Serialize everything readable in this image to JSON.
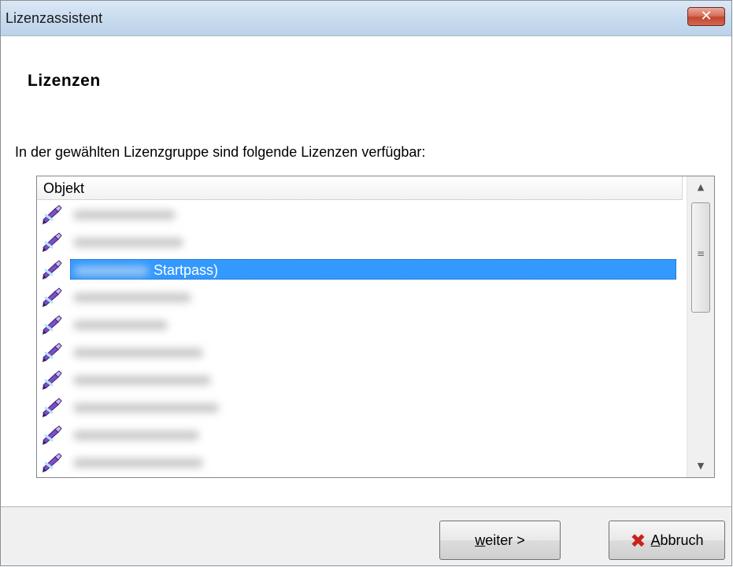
{
  "window": {
    "title": "Lizenzassistent",
    "close_glyph": "✕"
  },
  "page": {
    "heading": "Lizenzen",
    "description": "In der gewählten Lizenzgruppe sind folgende Lizenzen verfügbar:"
  },
  "list": {
    "column_header": "Objekt",
    "selected_index": 2,
    "rows": [
      {
        "label": "",
        "icon": "license-pen-icon"
      },
      {
        "label": "",
        "icon": "license-pen-icon"
      },
      {
        "label": "Startpass)",
        "icon": "license-pen-icon"
      },
      {
        "label": "",
        "icon": "license-pen-icon"
      },
      {
        "label": "",
        "icon": "license-pen-icon"
      },
      {
        "label": "",
        "icon": "license-pen-icon"
      },
      {
        "label": "",
        "icon": "license-pen-icon"
      },
      {
        "label": "",
        "icon": "license-pen-icon"
      },
      {
        "label": "",
        "icon": "license-pen-icon"
      },
      {
        "label": "",
        "icon": "license-pen-icon"
      }
    ]
  },
  "buttons": {
    "next_mnemonic": "w",
    "next_rest": "eiter >",
    "cancel_mnemonic": "A",
    "cancel_rest": "bbruch"
  },
  "colors": {
    "selection": "#3399ff",
    "cancel_icon": "#c8221c",
    "titlebar": "#c9dcef"
  }
}
